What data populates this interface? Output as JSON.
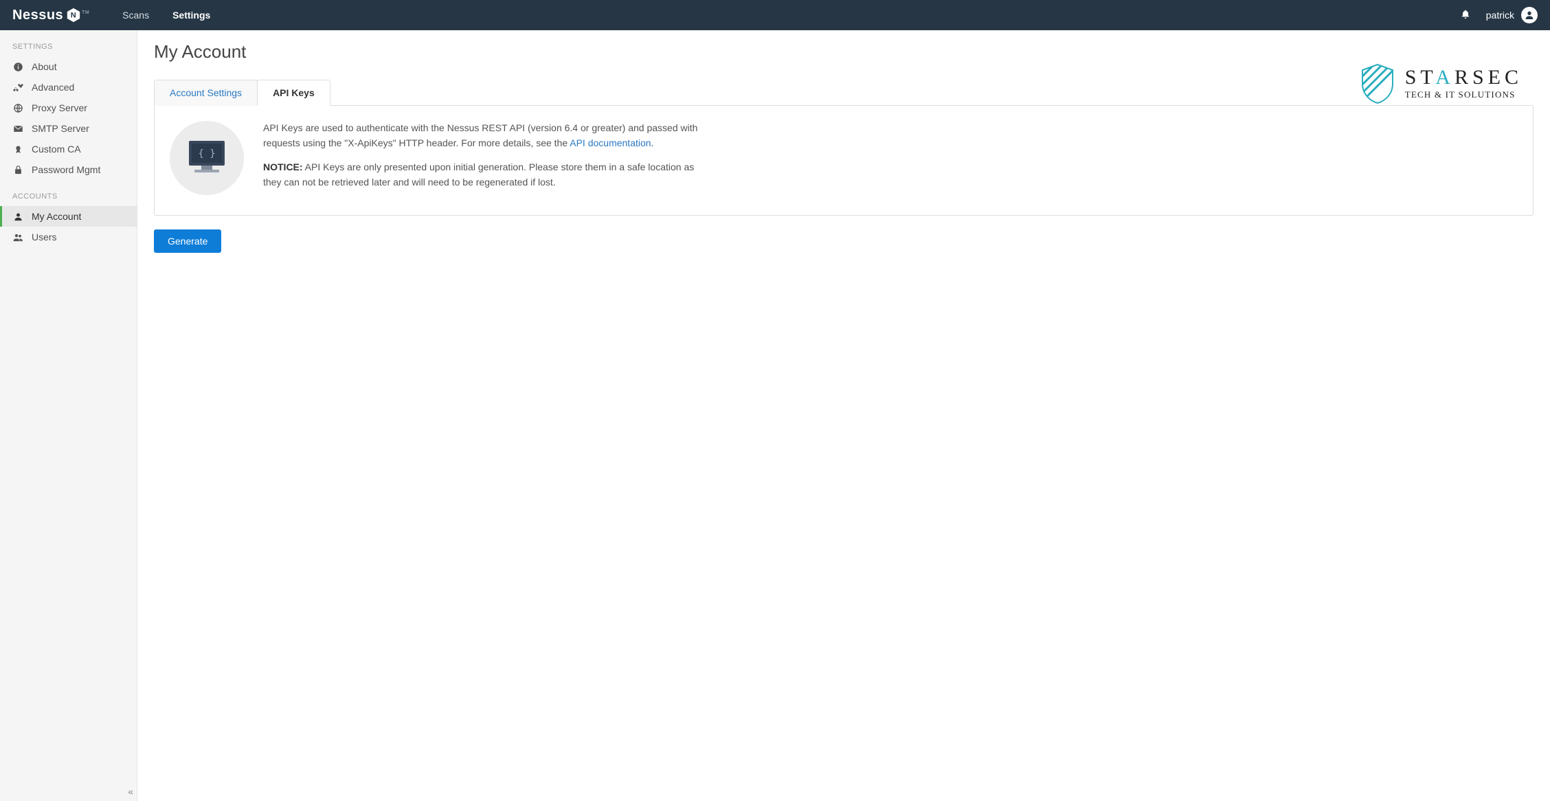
{
  "brand": {
    "name": "Nessus",
    "badge": "N",
    "tm": "TM"
  },
  "nav": {
    "links": [
      {
        "label": "Scans",
        "active": false
      },
      {
        "label": "Settings",
        "active": true
      }
    ],
    "user": "patrick"
  },
  "sidebar": {
    "sections": [
      {
        "title": "SETTINGS",
        "items": [
          {
            "icon": "info",
            "label": "About"
          },
          {
            "icon": "tools",
            "label": "Advanced"
          },
          {
            "icon": "globe",
            "label": "Proxy Server"
          },
          {
            "icon": "mail",
            "label": "SMTP Server"
          },
          {
            "icon": "ribbon",
            "label": "Custom CA"
          },
          {
            "icon": "lock",
            "label": "Password Mgmt"
          }
        ]
      },
      {
        "title": "ACCOUNTS",
        "items": [
          {
            "icon": "user",
            "label": "My Account",
            "active": true
          },
          {
            "icon": "users",
            "label": "Users"
          }
        ]
      }
    ],
    "collapse_glyph": "«"
  },
  "page": {
    "title": "My Account"
  },
  "tabs": [
    {
      "label": "Account Settings",
      "active": false
    },
    {
      "label": "API Keys",
      "active": true
    }
  ],
  "api_keys": {
    "desc_part1": "API Keys are used to authenticate with the Nessus REST API (version 6.4 or greater) and passed with requests using the \"X-ApiKeys\" HTTP header. For more details, see the ",
    "desc_link": "API documentation",
    "desc_part2": ".",
    "notice_label": "NOTICE:",
    "notice_text": " API Keys are only presented upon initial generation. Please store them in a safe location as they can not be retrieved later and will need to be regenerated if lost.",
    "generate_label": "Generate"
  },
  "watermark": {
    "title_pre": "ST",
    "title_tri": "A",
    "title_post": "RSEC",
    "subtitle": "TECH & IT SOLUTIONS"
  }
}
